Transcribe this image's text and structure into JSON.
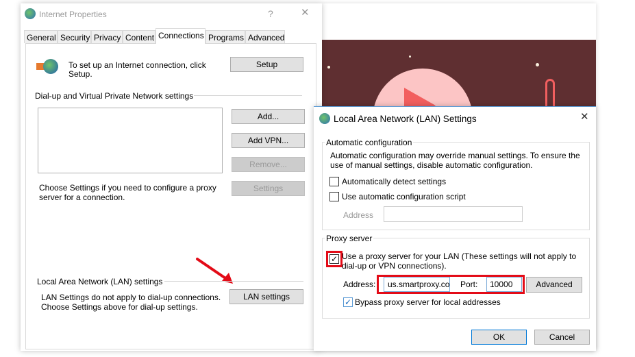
{
  "internet_properties": {
    "title": "Internet Properties",
    "help": "?",
    "close": "✕",
    "tabs": [
      "General",
      "Security",
      "Privacy",
      "Content",
      "Connections",
      "Programs",
      "Advanced"
    ],
    "setup_text_1": "To set up an Internet connection, click",
    "setup_text_2": "Setup.",
    "setup_button": "Setup",
    "dialup_heading": "Dial-up and Virtual Private Network settings",
    "add_button": "Add...",
    "add_vpn_button": "Add VPN...",
    "remove_button": "Remove...",
    "settings_button": "Settings",
    "choose_text_1": "Choose Settings if you need to configure a proxy",
    "choose_text_2": "server for a connection.",
    "lan_heading": "Local Area Network (LAN) settings",
    "lan_text_1": "LAN Settings do not apply to dial-up connections.",
    "lan_text_2": "Choose Settings above for dial-up settings.",
    "lan_settings_button": "LAN settings"
  },
  "lan_dialog": {
    "title": "Local Area Network (LAN) Settings",
    "close": "✕",
    "auto_group": "Automatic configuration",
    "auto_text_1": "Automatic configuration may override manual settings.  To ensure the",
    "auto_text_2": "use of manual settings, disable automatic configuration.",
    "auto_detect": {
      "label": "Automatically detect settings",
      "checked": false
    },
    "auto_script": {
      "label": "Use automatic configuration script",
      "checked": false
    },
    "address_label_disabled": "Address",
    "proxy_group": "Proxy server",
    "use_proxy": {
      "label_1": "Use a proxy server for your LAN (These settings will not apply to",
      "label_2": "dial-up or VPN connections).",
      "checked": true
    },
    "address_label": "Address:",
    "address_value": "us.smartproxy.co",
    "port_label": "Port:",
    "port_value": "10000",
    "advanced_button": "Advanced",
    "bypass": {
      "label": "Bypass proxy server for local addresses",
      "checked": true
    },
    "ok_button": "OK",
    "cancel_button": "Cancel",
    "check": "✓"
  },
  "colors": {
    "highlight": "#e30b17",
    "banner": "#5f2f31"
  }
}
